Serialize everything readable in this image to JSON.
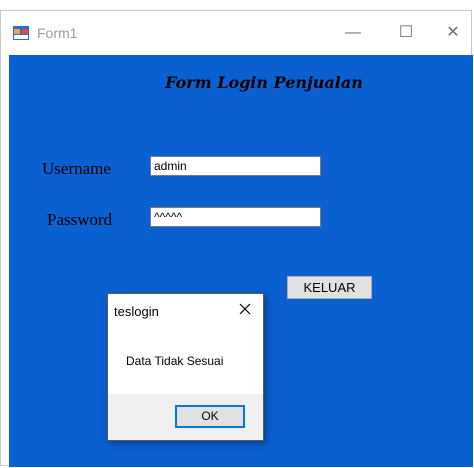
{
  "window": {
    "title": "Form1",
    "minimize_glyph": "—",
    "maximize_glyph": "☐",
    "close_glyph": "✕"
  },
  "form": {
    "title": "Form Login Penjualan",
    "username_label": "Username",
    "username_value": "admin",
    "password_label": "Password",
    "password_value": "^^^^^",
    "keluar_button": "KELUAR"
  },
  "dialog": {
    "title": "teslogin",
    "message": "Data Tidak Sesuai",
    "ok_button": "OK"
  },
  "colors": {
    "client_background": "#0a5fd1",
    "button_face": "#e1e1e1",
    "focus_border": "#0078d7"
  }
}
